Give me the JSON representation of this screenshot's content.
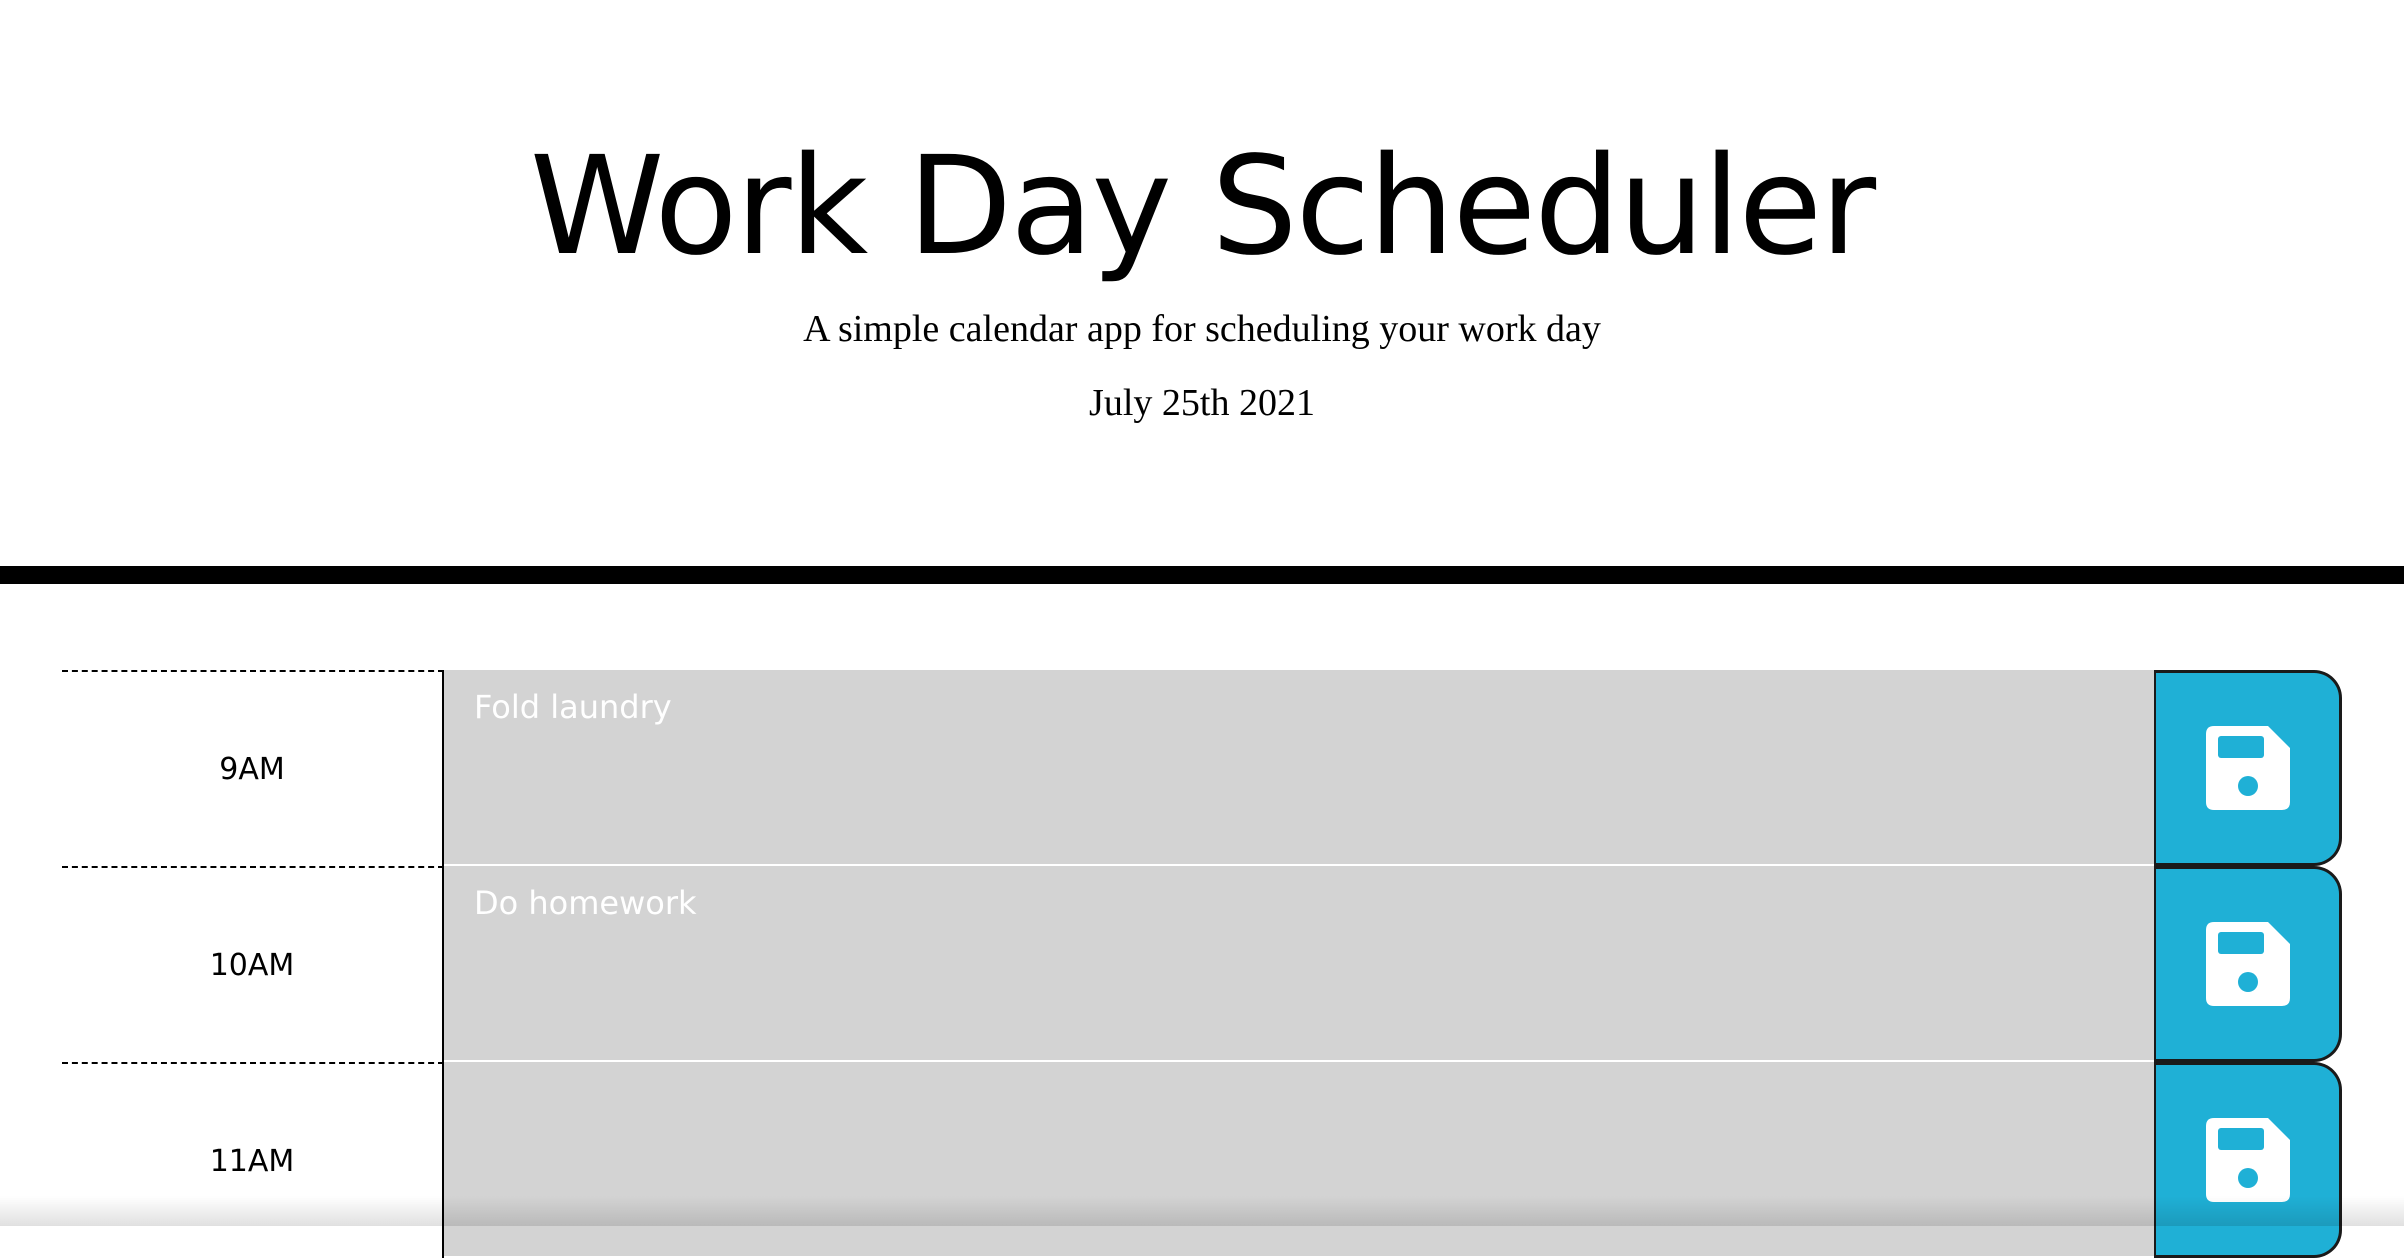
{
  "header": {
    "title": "Work Day Scheduler",
    "lead": "A simple calendar app for scheduling your work day",
    "current_day": "July 25th 2021"
  },
  "colors": {
    "past": "#d3d3d3",
    "save_button": "#1fb0d6",
    "divider": "#000000"
  },
  "time_blocks": [
    {
      "hour": "9AM",
      "description": "Fold laundry",
      "save_icon": "floppy-disk-icon"
    },
    {
      "hour": "10AM",
      "description": "Do homework",
      "save_icon": "floppy-disk-icon"
    },
    {
      "hour": "11AM",
      "description": "",
      "save_icon": "floppy-disk-icon"
    }
  ]
}
